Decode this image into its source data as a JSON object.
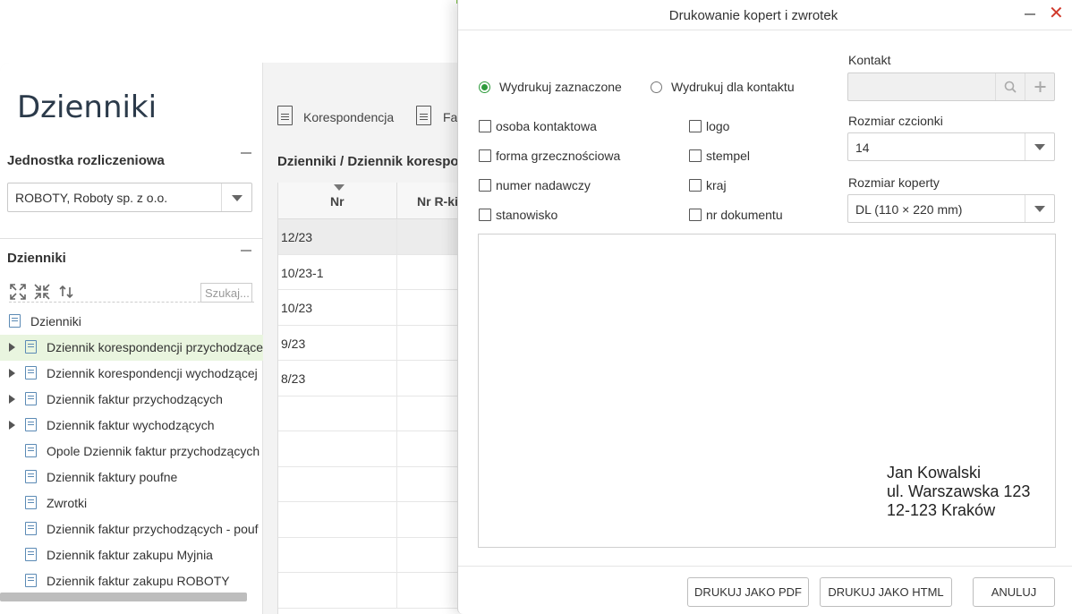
{
  "left": {
    "title": "Dzienniki",
    "unit_label": "Jednostka rozliczeniowa",
    "unit_value": "ROBOTY, Roboty sp. z o.o.",
    "journals_label": "Dzienniki",
    "search_placeholder": "Szukaj...",
    "tree_root": "Dzienniki",
    "tree_items": [
      {
        "label": "Dziennik korespondencji przychodzące",
        "expandable": true,
        "selected": true
      },
      {
        "label": "Dziennik korespondencji wychodzącej",
        "expandable": true,
        "selected": false
      },
      {
        "label": "Dziennik faktur przychodzących",
        "expandable": true,
        "selected": false
      },
      {
        "label": "Dziennik faktur wychodzących",
        "expandable": true,
        "selected": false
      },
      {
        "label": "Opole Dziennik faktur przychodzących",
        "expandable": false,
        "selected": false
      },
      {
        "label": "Dziennik faktury poufne",
        "expandable": false,
        "selected": false
      },
      {
        "label": "Zwrotki",
        "expandable": false,
        "selected": false
      },
      {
        "label": "Dziennik faktur przychodzących - pouf",
        "expandable": false,
        "selected": false
      },
      {
        "label": "Dziennik faktur zakupu Myjnia",
        "expandable": false,
        "selected": false
      },
      {
        "label": "Dziennik faktur zakupu ROBOTY",
        "expandable": false,
        "selected": false
      }
    ]
  },
  "main": {
    "toolbar": {
      "korespondencja": "Korespondencja",
      "fa": "Fa"
    },
    "breadcrumb": "Dzienniki / Dziennik korespon",
    "columns": {
      "nr": "Nr",
      "nr_rki": "Nr R-ki"
    },
    "rows": [
      "12/23",
      "10/23-1",
      "10/23",
      "9/23",
      "8/23",
      "",
      "",
      "",
      "",
      "",
      ""
    ]
  },
  "dialog": {
    "title": "Drukowanie kopert i zwrotek",
    "radio_selected": "Wydrukuj zaznaczone",
    "radio_contact": "Wydrukuj dla kontaktu",
    "checkboxes_left": [
      "osoba kontaktowa",
      "forma grzecznościowa",
      "numer nadawczy",
      "stanowisko"
    ],
    "checkboxes_right": [
      "logo",
      "stempel",
      "kraj",
      "nr dokumentu"
    ],
    "contact_label": "Kontakt",
    "contact_value": "",
    "font_size_label": "Rozmiar czcionki",
    "font_size_value": "14",
    "envelope_size_label": "Rozmiar koperty",
    "envelope_size_value": "DL (110 × 220 mm)",
    "address": {
      "name": "Jan Kowalski",
      "street": "ul. Warszawska 123",
      "city": "12-123 Kraków"
    },
    "buttons": {
      "pdf": "DRUKUJ JAKO PDF",
      "html": "DRUKUJ JAKO HTML",
      "cancel": "ANULUJ"
    }
  }
}
